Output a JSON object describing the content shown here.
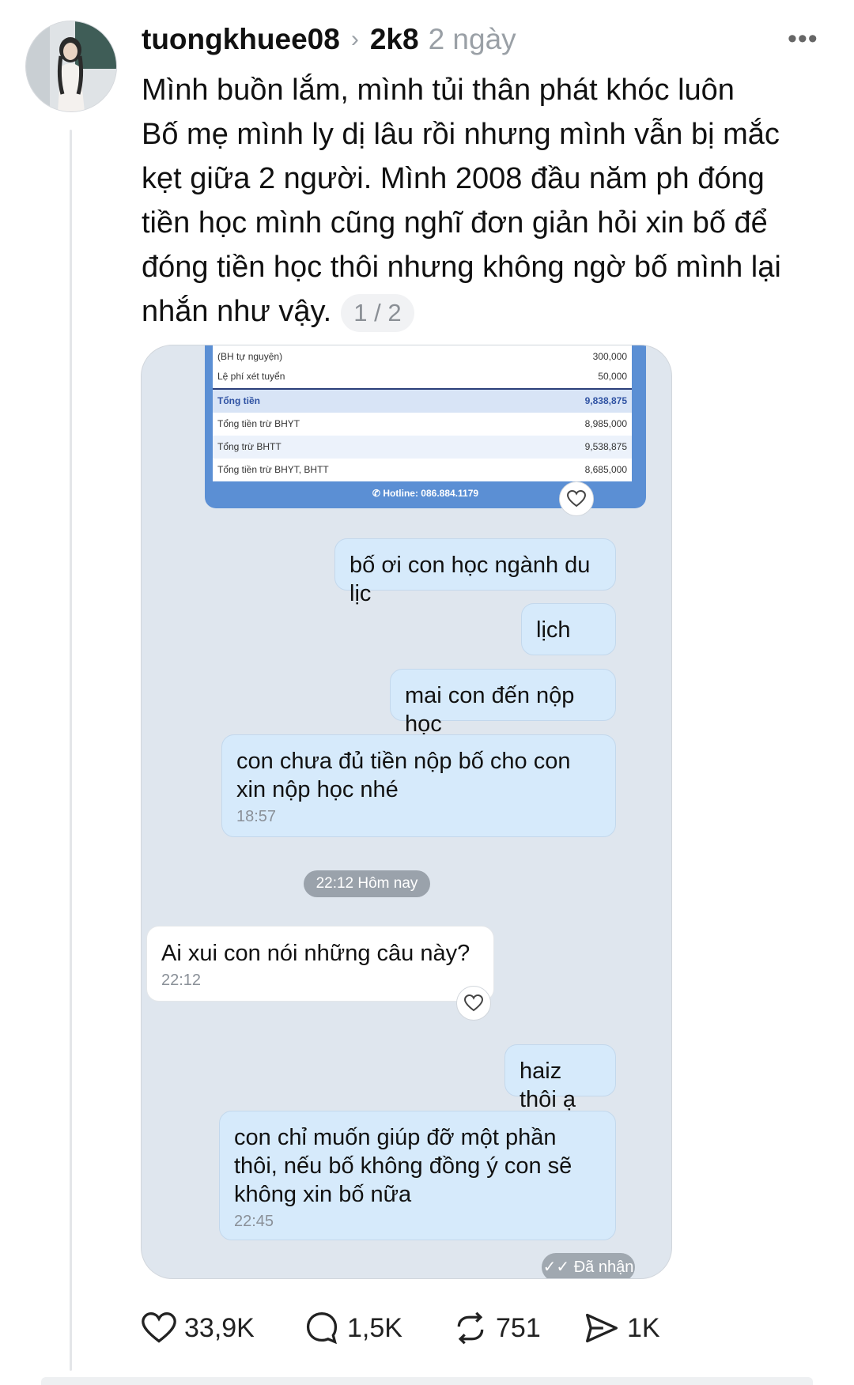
{
  "post": {
    "username": "tuongkhuee08",
    "topic": "2k8",
    "time": "2 ngày",
    "lines": [
      "Mình buồn lắm, mình tủi thân phát khóc luôn",
      "Bố mẹ mình ly dị lâu rồi nhưng mình vẫn bị mắc",
      "kẹt giữa 2 người. Mình 2008 đầu năm ph đóng",
      "tiền học mình cũng nghĩ đơn giản hỏi xin bố để",
      "đóng tiền học thôi nhưng không ngờ bố mình lại",
      "nhắn như vậy."
    ],
    "page_indicator": "1 / 2"
  },
  "invoice": {
    "rows": [
      {
        "label": "(BH tự nguyện)",
        "value": "300,000"
      },
      {
        "label": "Lệ phí xét tuyển",
        "value": "50,000"
      },
      {
        "label": "Tổng tiền",
        "value": "9,838,875"
      },
      {
        "label": "Tổng tiền trừ BHYT",
        "value": "8,985,000"
      },
      {
        "label": "Tổng trừ BHTT",
        "value": "9,538,875"
      },
      {
        "label": "Tổng tiền trừ BHYT, BHTT",
        "value": "8,685,000"
      }
    ],
    "hotline": "Hotline: 086.884.1179"
  },
  "chat": {
    "m1": "bố ơi con học ngành du lịc",
    "m2": "lịch",
    "m3": "mai con đến nộp học",
    "m4": "con chưa đủ tiền nộp bố cho con xin nộp học nhé",
    "m4_time": "18:57",
    "day_separator": "22:12 Hôm nay",
    "m5": "Ai xui con nói những câu này?",
    "m5_time": "22:12",
    "m6": "haiz thôi ạ",
    "m7": "con chỉ muốn giúp đỡ một phần thôi, nếu bố không đồng ý con sẽ không xin bố nữa",
    "m7_time": "22:45",
    "status": "Đã nhận"
  },
  "actions": {
    "likes": "33,9K",
    "comments": "1,5K",
    "reposts": "751",
    "shares": "1K"
  },
  "icons": [
    "more-icon",
    "chevron-right-icon",
    "heart-icon",
    "comment-icon",
    "repost-icon",
    "share-icon",
    "double-check-icon",
    "phone-icon"
  ],
  "colors": {
    "outgoing_bubble": "#d6eafb",
    "incoming_bubble": "#ffffff",
    "chat_bg": "#dfe6ee",
    "invoice_header": "#5b8fd4"
  }
}
